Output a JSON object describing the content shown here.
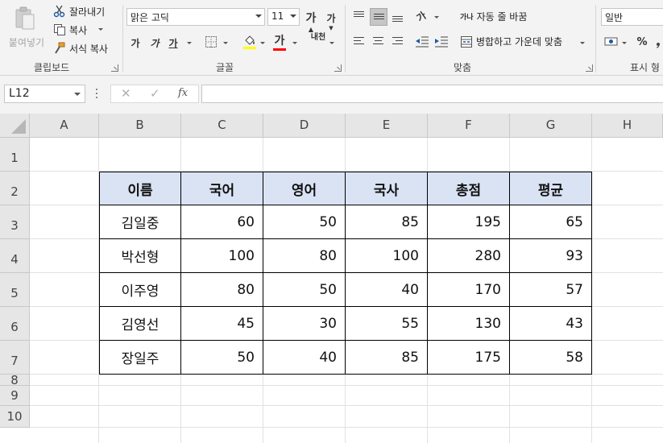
{
  "ribbon": {
    "clipboard": {
      "paste_label": "붙여넣기",
      "cut_label": "잘라내기",
      "copy_label": "복사",
      "format_painter_label": "서식 복사",
      "group_label": "클립보드"
    },
    "font": {
      "font_name": "맑은 고딕",
      "font_size": "11",
      "grow_label": "가",
      "shrink_label": "가",
      "bold_label": "가",
      "italic_label": "가",
      "underline_label": "가",
      "font_color_label": "가",
      "phonetic_label": "내천",
      "group_label": "글꼴",
      "highlight_color": "#ffff00",
      "font_color": "#ff0000"
    },
    "alignment": {
      "wrap_text_label": "자동 줄 바꿈",
      "merge_center_label": "병합하고 가운데 맞춤",
      "orientation_glyph": "가",
      "wrap_glyph": "가나",
      "group_label": "맞춤"
    },
    "number": {
      "format_value": "일반",
      "percent_glyph": "%",
      "group_label": "표시 형"
    }
  },
  "formula_bar": {
    "name_box": "L12",
    "cancel_glyph": "✕",
    "enter_glyph": "✓",
    "function_glyph": "fx",
    "formula": ""
  },
  "sheet": {
    "columns": [
      "A",
      "B",
      "C",
      "D",
      "E",
      "F",
      "G",
      "H"
    ],
    "rows": [
      "1",
      "2",
      "3",
      "4",
      "5",
      "6",
      "7",
      "8",
      "9",
      "10"
    ],
    "table": {
      "headers": [
        "이름",
        "국어",
        "영어",
        "국사",
        "총점",
        "평균"
      ],
      "rows": [
        [
          "김일중",
          "60",
          "50",
          "85",
          "195",
          "65"
        ],
        [
          "박선형",
          "100",
          "80",
          "100",
          "280",
          "93"
        ],
        [
          "이주영",
          "80",
          "50",
          "40",
          "170",
          "57"
        ],
        [
          "김영선",
          "45",
          "30",
          "55",
          "130",
          "43"
        ],
        [
          "장일주",
          "50",
          "40",
          "85",
          "175",
          "58"
        ]
      ],
      "header_fill": "#dae3f3"
    }
  }
}
